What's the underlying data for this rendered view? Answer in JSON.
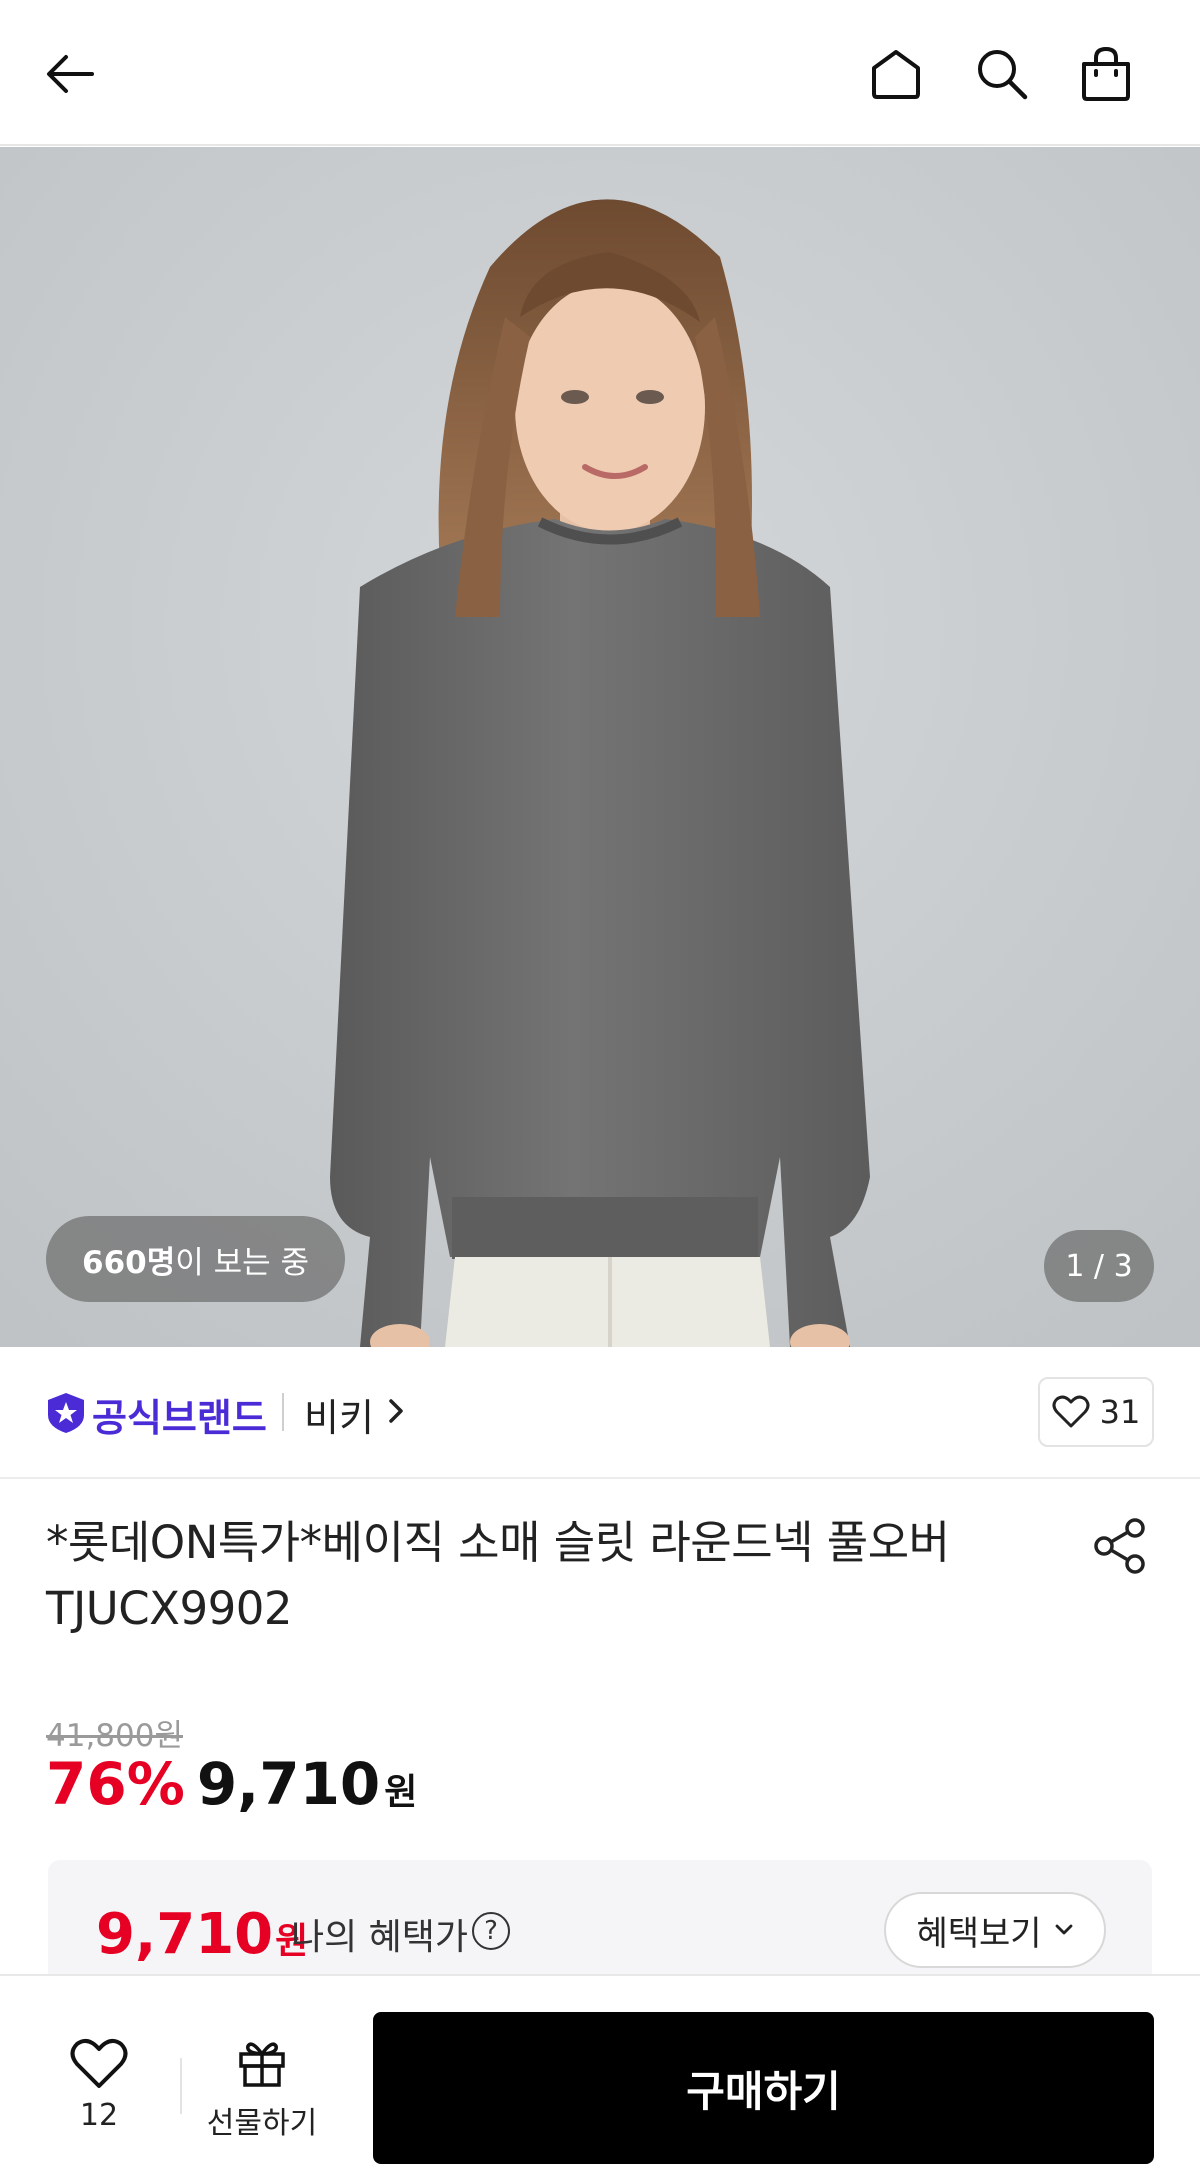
{
  "header": {
    "icons": [
      "back-arrow-icon",
      "home-icon",
      "search-icon",
      "shopping-bag-icon"
    ]
  },
  "hero": {
    "viewers_count": "660명",
    "viewers_suffix": "이 보는 중",
    "pager": "1 / 3"
  },
  "brand": {
    "official_label": "공식브랜드",
    "name": "비키",
    "like_count": "31"
  },
  "product": {
    "title": "*롯데ON특가*베이직 소매 슬릿 라운드넥 풀오버 TJUCX9902",
    "original_price": "41,800원",
    "discount_rate": "76%",
    "price": "9,710",
    "currency": "원"
  },
  "benefit": {
    "price": "9,710",
    "currency": "원",
    "label": "나의 혜택가",
    "help": "?",
    "button_label": "혜택보기"
  },
  "bottom": {
    "wish_count": "12",
    "gift_label": "선물하기",
    "buy_label": "구매하기"
  },
  "colors": {
    "accent_red": "#e60023",
    "brand_purple": "#4b2bd6",
    "buy_button": "#000000"
  }
}
